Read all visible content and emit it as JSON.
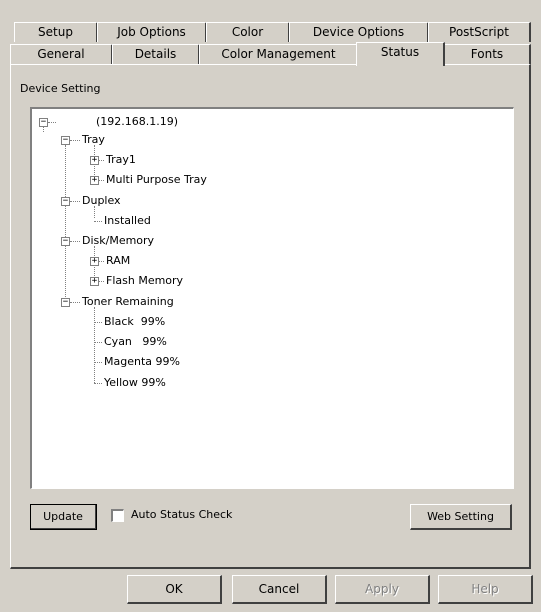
{
  "tabs_back": [
    {
      "label": "Setup"
    },
    {
      "label": "Job Options"
    },
    {
      "label": "Color"
    },
    {
      "label": "Device Options"
    },
    {
      "label": "PostScript"
    }
  ],
  "tabs_front": [
    {
      "label": "General"
    },
    {
      "label": "Details"
    },
    {
      "label": "Color Management"
    },
    {
      "label": "Status",
      "active": true
    },
    {
      "label": "Fonts"
    }
  ],
  "group_label": "Device Setting",
  "tree": {
    "root": "(192.168.1.19)",
    "tray": "Tray",
    "tray1": "Tray1",
    "multi_purpose_tray": "Multi Purpose Tray",
    "duplex": "Duplex",
    "installed": "Installed",
    "disk_memory": "Disk/Memory",
    "ram": "RAM",
    "flash_memory": "Flash Memory",
    "toner_remaining": "Toner Remaining",
    "black": "Black  99%",
    "cyan": "Cyan   99%",
    "magenta": "Magenta 99%",
    "yellow": "Yellow 99%"
  },
  "controls": {
    "update": "Update",
    "auto_status_check": "Auto Status Check",
    "auto_status_checked": false,
    "web_setting": "Web Setting"
  },
  "footer": {
    "ok": "OK",
    "cancel": "Cancel",
    "apply": "Apply",
    "help": "Help"
  }
}
